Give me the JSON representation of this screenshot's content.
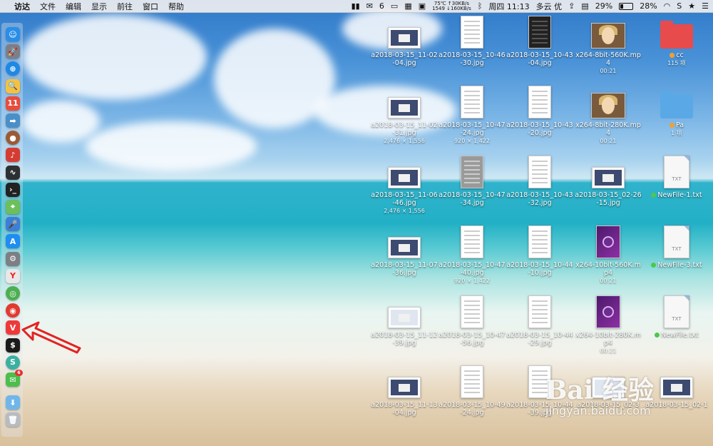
{
  "menubar": {
    "app_name": "访达",
    "menus": [
      "文件",
      "编辑",
      "显示",
      "前往",
      "窗口",
      "帮助"
    ],
    "wechat_count": "6",
    "net_temp": "75℃ ↑30KB/s",
    "net_rpm": "1549 ↓160KB/s",
    "clock": "周四 11:13",
    "weather": "多云 优",
    "cpu_percent": "29%",
    "battery_percent": "28%"
  },
  "dock": {
    "icons": [
      {
        "name": "finder-icon",
        "glyph": "☺",
        "color": "#2a8ee8"
      },
      {
        "name": "launchpad-icon",
        "glyph": "🚀",
        "color": "#7d7f88"
      },
      {
        "name": "safari-icon",
        "glyph": "⊕",
        "color": "#1e88e5"
      },
      {
        "name": "preview-icon",
        "glyph": "🔍",
        "color": "#f4c243"
      },
      {
        "name": "calendar-icon",
        "glyph": "11",
        "color": "#e74c3c"
      },
      {
        "name": "migration-icon",
        "glyph": "➡",
        "color": "#4a90c8"
      },
      {
        "name": "basketball-icon",
        "glyph": "●",
        "color": "#9b5a36"
      },
      {
        "name": "netease-music-icon",
        "glyph": "♪",
        "color": "#d43c33"
      },
      {
        "name": "activity-monitor-icon",
        "glyph": "∿",
        "color": "#2d3033"
      },
      {
        "name": "terminal-icon",
        "glyph": "›_",
        "color": "#222"
      },
      {
        "name": "maps-icon",
        "glyph": "⌖",
        "color": "#6cbf5b"
      },
      {
        "name": "siri-icon",
        "glyph": "🎤",
        "color": "#3d7fd6"
      },
      {
        "name": "app-store-icon",
        "glyph": "A",
        "color": "#1f8ef1"
      },
      {
        "name": "system-preferences-icon",
        "glyph": "⚙",
        "color": "#7c7f84"
      },
      {
        "name": "yandex-icon",
        "glyph": "Y",
        "color": "#e8e8e8"
      },
      {
        "name": "chrome-icon",
        "glyph": "◎",
        "color": "#4caf50"
      },
      {
        "name": "netease-cloud-icon",
        "glyph": "◉",
        "color": "#e03a2f"
      },
      {
        "name": "vivaldi-icon",
        "glyph": "V",
        "color": "#ef3939"
      },
      {
        "name": "iterm-icon",
        "glyph": "$",
        "color": "#1a1a1a"
      },
      {
        "name": "sogou-icon",
        "glyph": "S",
        "color": "#3ab0a0"
      },
      {
        "name": "wechat-icon",
        "glyph": "✉",
        "color": "#4cbe4c",
        "badge": "6"
      },
      {
        "name": "downloads-folder-icon",
        "glyph": "⬇",
        "color": "#6fb7ea"
      },
      {
        "name": "trash-icon",
        "glyph": "🗑",
        "color": "#b8bcc2"
      }
    ]
  },
  "desktop": {
    "items": [
      {
        "name": "a2018-03-15_11-02-04.jpg",
        "meta": "",
        "kind": "landscape"
      },
      {
        "name": "a2018-03-15_10-46-30.jpg",
        "meta": "",
        "kind": "portrait"
      },
      {
        "name": "a2018-03-15_10-43-04.jpg",
        "meta": "",
        "kind": "portrait-dark"
      },
      {
        "name": "x264-8bit-560K.mp4",
        "meta": "00:21",
        "kind": "video"
      },
      {
        "name": "cc",
        "meta": "115 项",
        "kind": "folder-red",
        "dot": "orange"
      },
      {
        "name": "a2018-03-15_11-02-31.jpg",
        "meta": "2,476 × 1,556",
        "kind": "landscape"
      },
      {
        "name": "a2018-03-15_10-47-24.jpg",
        "meta": "920 × 1,422",
        "kind": "portrait"
      },
      {
        "name": "a2018-03-15_10-43-20.jpg",
        "meta": "",
        "kind": "portrait"
      },
      {
        "name": "x264-8bit-280K.mp4",
        "meta": "00:21",
        "kind": "video"
      },
      {
        "name": "Pa",
        "meta": "1 项",
        "kind": "folder-blue",
        "dot": "orange"
      },
      {
        "name": "a2018-03-15_11-06-46.jpg",
        "meta": "2,476 × 1,556",
        "kind": "landscape"
      },
      {
        "name": "a2018-03-15_10-47-34.jpg",
        "meta": "",
        "kind": "portrait-gray"
      },
      {
        "name": "a2018-03-15_10-43-32.jpg",
        "meta": "",
        "kind": "portrait"
      },
      {
        "name": "a2018-03-15_02-26-15.jpg",
        "meta": "",
        "kind": "landscape"
      },
      {
        "name": "NewFile-1.txt",
        "meta": "",
        "kind": "txt",
        "dot": "green"
      },
      {
        "name": "a2018-03-15_11-07-36.jpg",
        "meta": "",
        "kind": "landscape"
      },
      {
        "name": "a2018-03-15_10-47-40.jpg",
        "meta": "920 × 1,422",
        "kind": "portrait"
      },
      {
        "name": "a2018-03-15_10-44-10.jpg",
        "meta": "",
        "kind": "portrait"
      },
      {
        "name": "x264-10bit-560K.mp4",
        "meta": "00:21",
        "kind": "purple"
      },
      {
        "name": "NewFile-3.txt",
        "meta": "",
        "kind": "txt",
        "dot": "green"
      },
      {
        "name": "a2018-03-15_11-12-39.jpg",
        "meta": "",
        "kind": "landscape-light"
      },
      {
        "name": "a2018-03-15_10-47-56.jpg",
        "meta": "",
        "kind": "portrait"
      },
      {
        "name": "a2018-03-15_10-44-29.jpg",
        "meta": "",
        "kind": "portrait"
      },
      {
        "name": "x264-10bit-280K.mp4",
        "meta": "00:21",
        "kind": "purple"
      },
      {
        "name": "NewFile.txt",
        "meta": "",
        "kind": "txt",
        "dot": "green"
      },
      {
        "name": "a2018-03-15_11-13-04.jpg",
        "meta": "",
        "kind": "landscape"
      },
      {
        "name": "a2018-03-15_10-49-24.jpg",
        "meta": "",
        "kind": "portrait"
      },
      {
        "name": "a2018-03-15_10-44-39.jpg",
        "meta": "",
        "kind": "portrait"
      },
      {
        "name": "a2018-03-15_02-3",
        "meta": "",
        "kind": "landscape-light"
      },
      {
        "name": "a2018-03-15_02-1",
        "meta": "",
        "kind": "landscape"
      }
    ],
    "txt_label": "TXT"
  },
  "watermark": {
    "brand": "Bai 经验",
    "url": "jingyan.baidu.com"
  },
  "colors": {
    "arrow": "#e32222"
  }
}
